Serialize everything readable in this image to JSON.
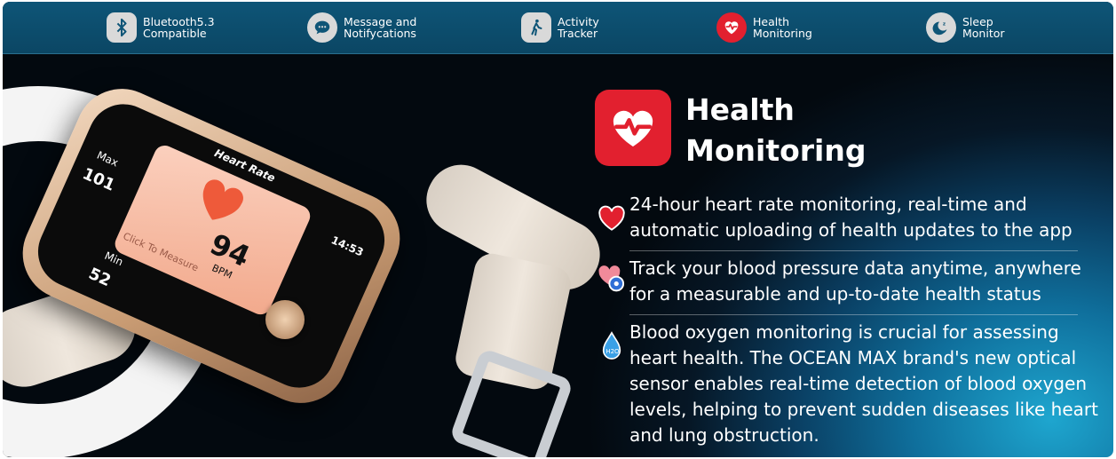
{
  "features": [
    {
      "icon": "bluetooth-icon",
      "line1": "Bluetooth5.3",
      "line2": "Compatible"
    },
    {
      "icon": "message-icon",
      "line1": "Message and",
      "line2": "Notifycations"
    },
    {
      "icon": "walking-icon",
      "line1": "Activity",
      "line2": "Tracker"
    },
    {
      "icon": "heart-pulse-icon",
      "line1": "Health",
      "line2": "Monitoring"
    },
    {
      "icon": "sleep-icon",
      "line1": "Sleep",
      "line2": "Monitor"
    }
  ],
  "watch": {
    "heading": "Heart Rate",
    "time": "14:53",
    "bpm_value": "94",
    "bpm_unit": "BPM",
    "measure_text": "Click To Measure",
    "max_label": "Max",
    "max_value": "101",
    "min_label": "Min",
    "min_value": "52"
  },
  "section": {
    "title_line1": "Health",
    "title_line2": "Monitoring"
  },
  "items": [
    {
      "icon": "heart-icon",
      "lines": [
        "24-hour heart rate monitoring, real-time and",
        "automatic uploading of health updates to the app"
      ]
    },
    {
      "icon": "blood-pressure-icon",
      "lines": [
        "Track your blood pressure data anytime, anywhere",
        "for a measurable and up-to-date health status"
      ]
    },
    {
      "icon": "water-drop-icon",
      "drop_label": "H2O",
      "lines": [
        "Blood oxygen monitoring is crucial for assessing",
        "heart health. The OCEAN MAX brand's new optical",
        "sensor enables real-time detection of blood oxygen",
        "levels, helping to prevent sudden diseases like heart",
        "and lung obstruction."
      ]
    }
  ],
  "colors": {
    "accent_red": "#e2202f",
    "icon_grey": "#d9d9d9",
    "bar": "#0e5577"
  }
}
